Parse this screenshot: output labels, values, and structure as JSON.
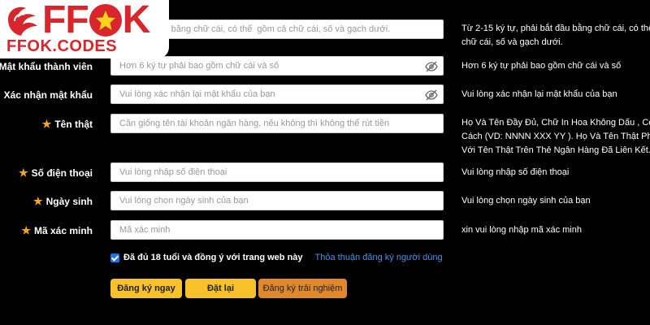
{
  "logo": {
    "wordmark_left": "FF",
    "wordmark_right": "K",
    "site": "FFOK.CODES"
  },
  "form": {
    "username": {
      "placeholder": "phải bắt đầu bằng chữ cái, có thể  gồm cả chữ cái, số và gạch dưới.",
      "hint_line1": "Từ 2-15 ký tự, phải bắt đầu bằng chữ cái, có thể gồm",
      "hint_line2": "chữ cái, số và gạch dưới."
    },
    "password": {
      "label": "Mật khẩu thành viên",
      "placeholder": "Hơn 6 ký tự phải bao gồm chữ cái và số",
      "hint": "Hơn 6 ký tự phải bao gồm chữ cái và số"
    },
    "confirm_password": {
      "label": "Xác nhận mật khẩu",
      "placeholder": "Vui lòng xác nhận lại mật khẩu của bạn",
      "hint": "Vui lòng xác nhận lại mật khẩu của bạn"
    },
    "real_name": {
      "label": "Tên thật",
      "placeholder": "Cần giống tên tài khoản ngân hàng, nếu không thì không thể rút tiền",
      "hint_line1": "Họ Và Tên Đầy Đủ, Chữ In Hoa Không Dấu , Có Dấu",
      "hint_line2": "Cách (VD: NNNN XXX YY ). Họ Và Tên Thật Phải Trùng",
      "hint_line3": "Với Tên Thật Trên Thẻ Ngân Hàng Đã Liên Kết."
    },
    "phone": {
      "label": "Số điện thoại",
      "placeholder": "Vui lòng nhập số điện thoại",
      "hint": "Vui lòng nhập số điện thoại"
    },
    "birthday": {
      "label": "Ngày sinh",
      "placeholder": "Vui lòng chọn ngày sinh của bạn",
      "hint": "Vui lòng chọn ngày sinh của bạn"
    },
    "captcha": {
      "label": "Mã xác minh",
      "placeholder": "Mã xác minh",
      "hint": "xin vui lòng nhập mã xác minh"
    },
    "agree": {
      "text": "Đã đủ 18 tuổi và đồng ý với trang web này",
      "link": "Thỏa thuận đăng ký người dùng"
    }
  },
  "buttons": {
    "register": "Đăng ký ngay",
    "reset": "Đặt lại",
    "trial": "Đăng ký trải nghiệm"
  },
  "colors": {
    "background": "#000000",
    "star": "#f5a623",
    "primary_button": "#f7c12b",
    "trial_button": "#e0892c",
    "link": "#4a90e2",
    "brand": "#d8262c"
  }
}
